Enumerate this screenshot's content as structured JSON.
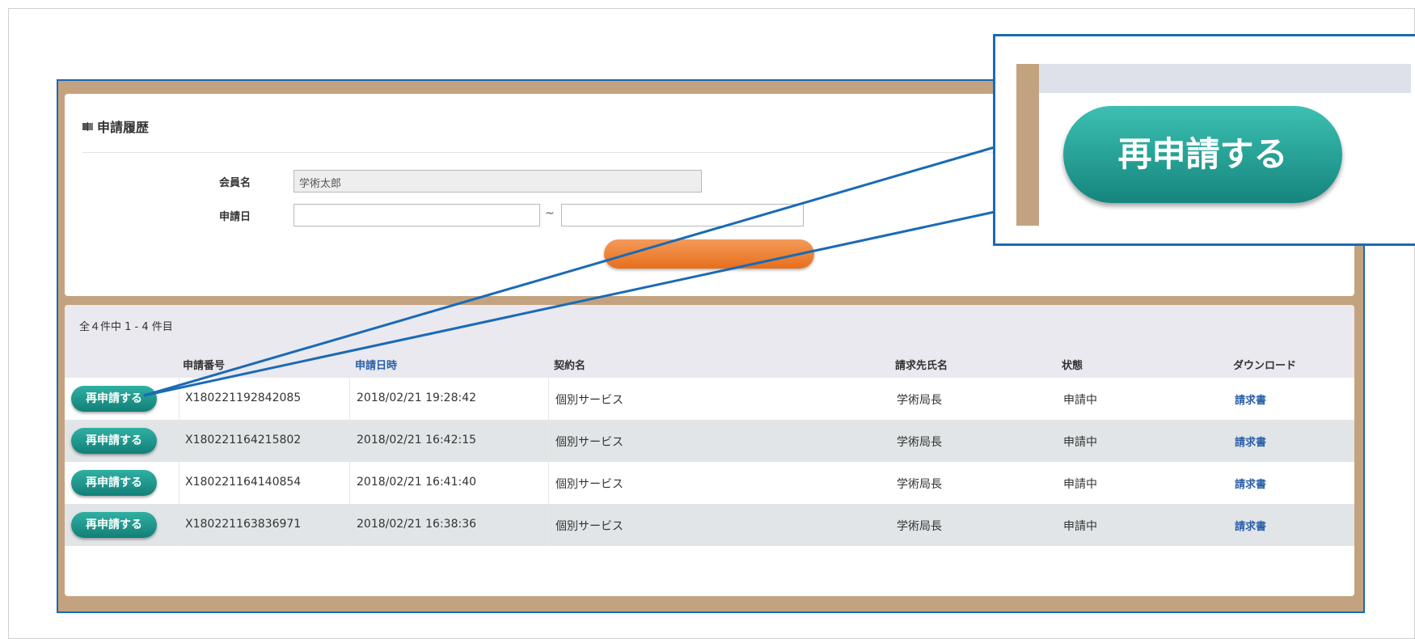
{
  "section_title": "申請履歴",
  "search": {
    "member_label": "会員名",
    "member_value": "学術太郎",
    "date_label": "申請日",
    "date_from_value": "",
    "date_to_value": "",
    "date_separator": "~"
  },
  "results": {
    "count_text": "全４件中 1 - 4 件目",
    "columns": [
      "申請番号",
      "申請日時",
      "契約名",
      "請求先氏名",
      "状態",
      "ダウンロード"
    ],
    "rows": [
      {
        "action": "再申請する",
        "number": "X180221192842085",
        "datetime": "2018/02/21 19:28:42",
        "contract": "個別サービス",
        "billing_name": "学術局長",
        "status": "申請中",
        "download": "請求書"
      },
      {
        "action": "再申請する",
        "number": "X180221164215802",
        "datetime": "2018/02/21 16:42:15",
        "contract": "個別サービス",
        "billing_name": "学術局長",
        "status": "申請中",
        "download": "請求書"
      },
      {
        "action": "再申請する",
        "number": "X180221164140854",
        "datetime": "2018/02/21 16:41:40",
        "contract": "個別サービス",
        "billing_name": "学術局長",
        "status": "申請中",
        "download": "請求書"
      },
      {
        "action": "再申請する",
        "number": "X180221163836971",
        "datetime": "2018/02/21 16:38:36",
        "contract": "個別サービス",
        "billing_name": "学術局長",
        "status": "申請中",
        "download": "請求書"
      }
    ]
  },
  "callout": {
    "zoom_button_label": "再申請する"
  },
  "colors": {
    "teal_button": "#1a8f86",
    "orange_button": "#e8762a",
    "frame_brown": "#c3a37f",
    "callout_blue": "#1a6ab6",
    "link_blue": "#2a5fa8"
  },
  "icons": {
    "title_icon": "book-icon"
  }
}
